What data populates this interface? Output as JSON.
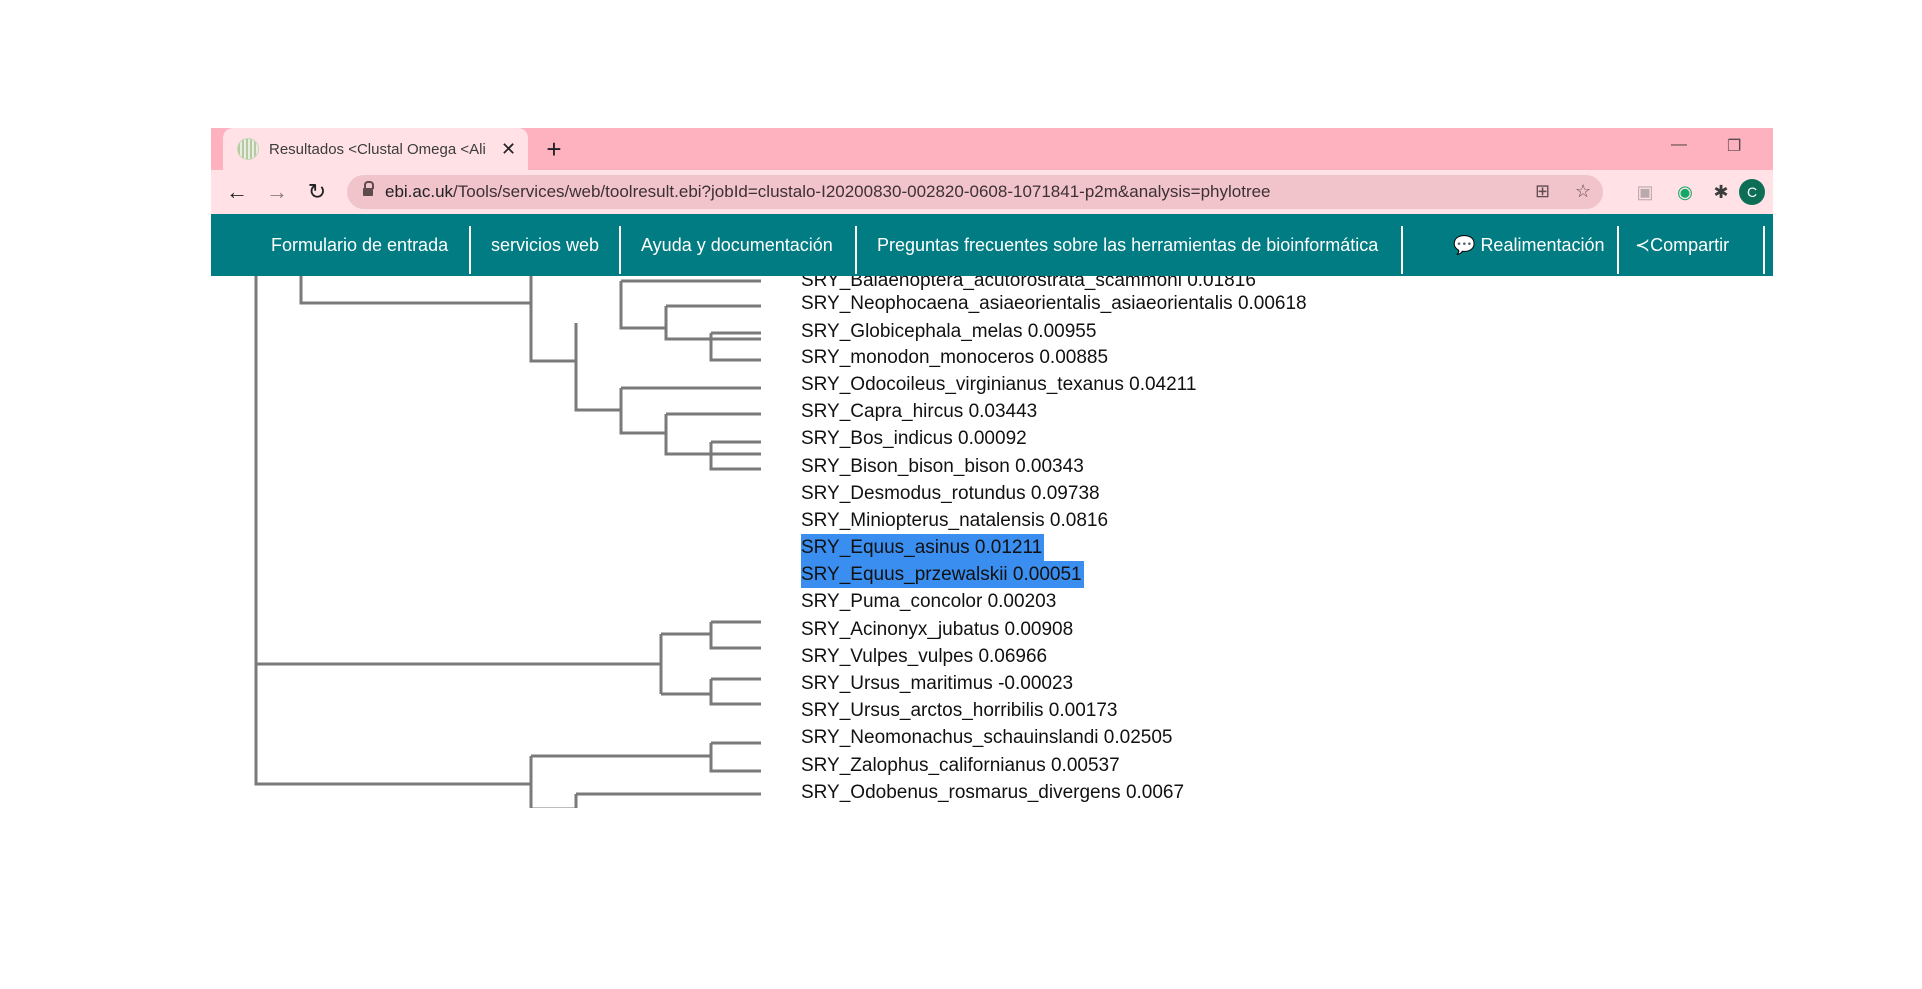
{
  "browser": {
    "tab_title": "Resultados <Clustal Omega <Ali",
    "new_tab_icon": "plus-icon",
    "url_domain": "ebi.ac.uk",
    "url_path": "/Tools/services/web/toolresult.ebi?jobId=clustalo-I20200830-002820-0608-1071841-p2m&analysis=phylotree",
    "profile_initial": "C"
  },
  "site_nav": {
    "items": [
      "Formulario de entrada",
      "servicios web",
      "Ayuda y documentación",
      "Preguntas frecuentes sobre las herramientas de bioinformática"
    ],
    "feedback": "Realimentación",
    "share": "Compartir"
  },
  "tree": {
    "leaves": [
      {
        "label": "SRY_Balaenoptera_acutorostrata_scammoni 0.01816",
        "selected": false
      },
      {
        "label": "SRY_Neophocaena_asiaeorientalis_asiaeorientalis 0.00618",
        "selected": false
      },
      {
        "label": "SRY_Globicephala_melas 0.00955",
        "selected": false
      },
      {
        "label": "SRY_monodon_monoceros 0.00885",
        "selected": false
      },
      {
        "label": "SRY_Odocoileus_virginianus_texanus 0.04211",
        "selected": false
      },
      {
        "label": "SRY_Capra_hircus 0.03443",
        "selected": false
      },
      {
        "label": "SRY_Bos_indicus 0.00092",
        "selected": false
      },
      {
        "label": "SRY_Bison_bison_bison 0.00343",
        "selected": false
      },
      {
        "label": "SRY_Desmodus_rotundus 0.09738",
        "selected": false
      },
      {
        "label": "SRY_Miniopterus_natalensis 0.0816",
        "selected": false
      },
      {
        "label": "SRY_Equus_asinus 0.01211",
        "selected": true
      },
      {
        "label": "SRY_Equus_przewalskii 0.00051",
        "selected": true
      },
      {
        "label": "SRY_Puma_concolor 0.00203",
        "selected": false
      },
      {
        "label": "SRY_Acinonyx_jubatus 0.00908",
        "selected": false
      },
      {
        "label": "SRY_Vulpes_vulpes 0.06966",
        "selected": false
      },
      {
        "label": "SRY_Ursus_maritimus -0.00023",
        "selected": false
      },
      {
        "label": "SRY_Ursus_arctos_horribilis 0.00173",
        "selected": false
      },
      {
        "label": "SRY_Neomonachus_schauinslandi 0.02505",
        "selected": false
      },
      {
        "label": "SRY_Zalophus_californianus 0.00537",
        "selected": false
      },
      {
        "label": "SRY_Odobenus_rosmarus_divergens 0.0067",
        "selected": false
      }
    ]
  },
  "colors": {
    "tabstrip": "#feb1bf",
    "nav_bar": "#007c82",
    "selection": "#3a8ef0",
    "tree_lines": "#7a7a7a"
  }
}
